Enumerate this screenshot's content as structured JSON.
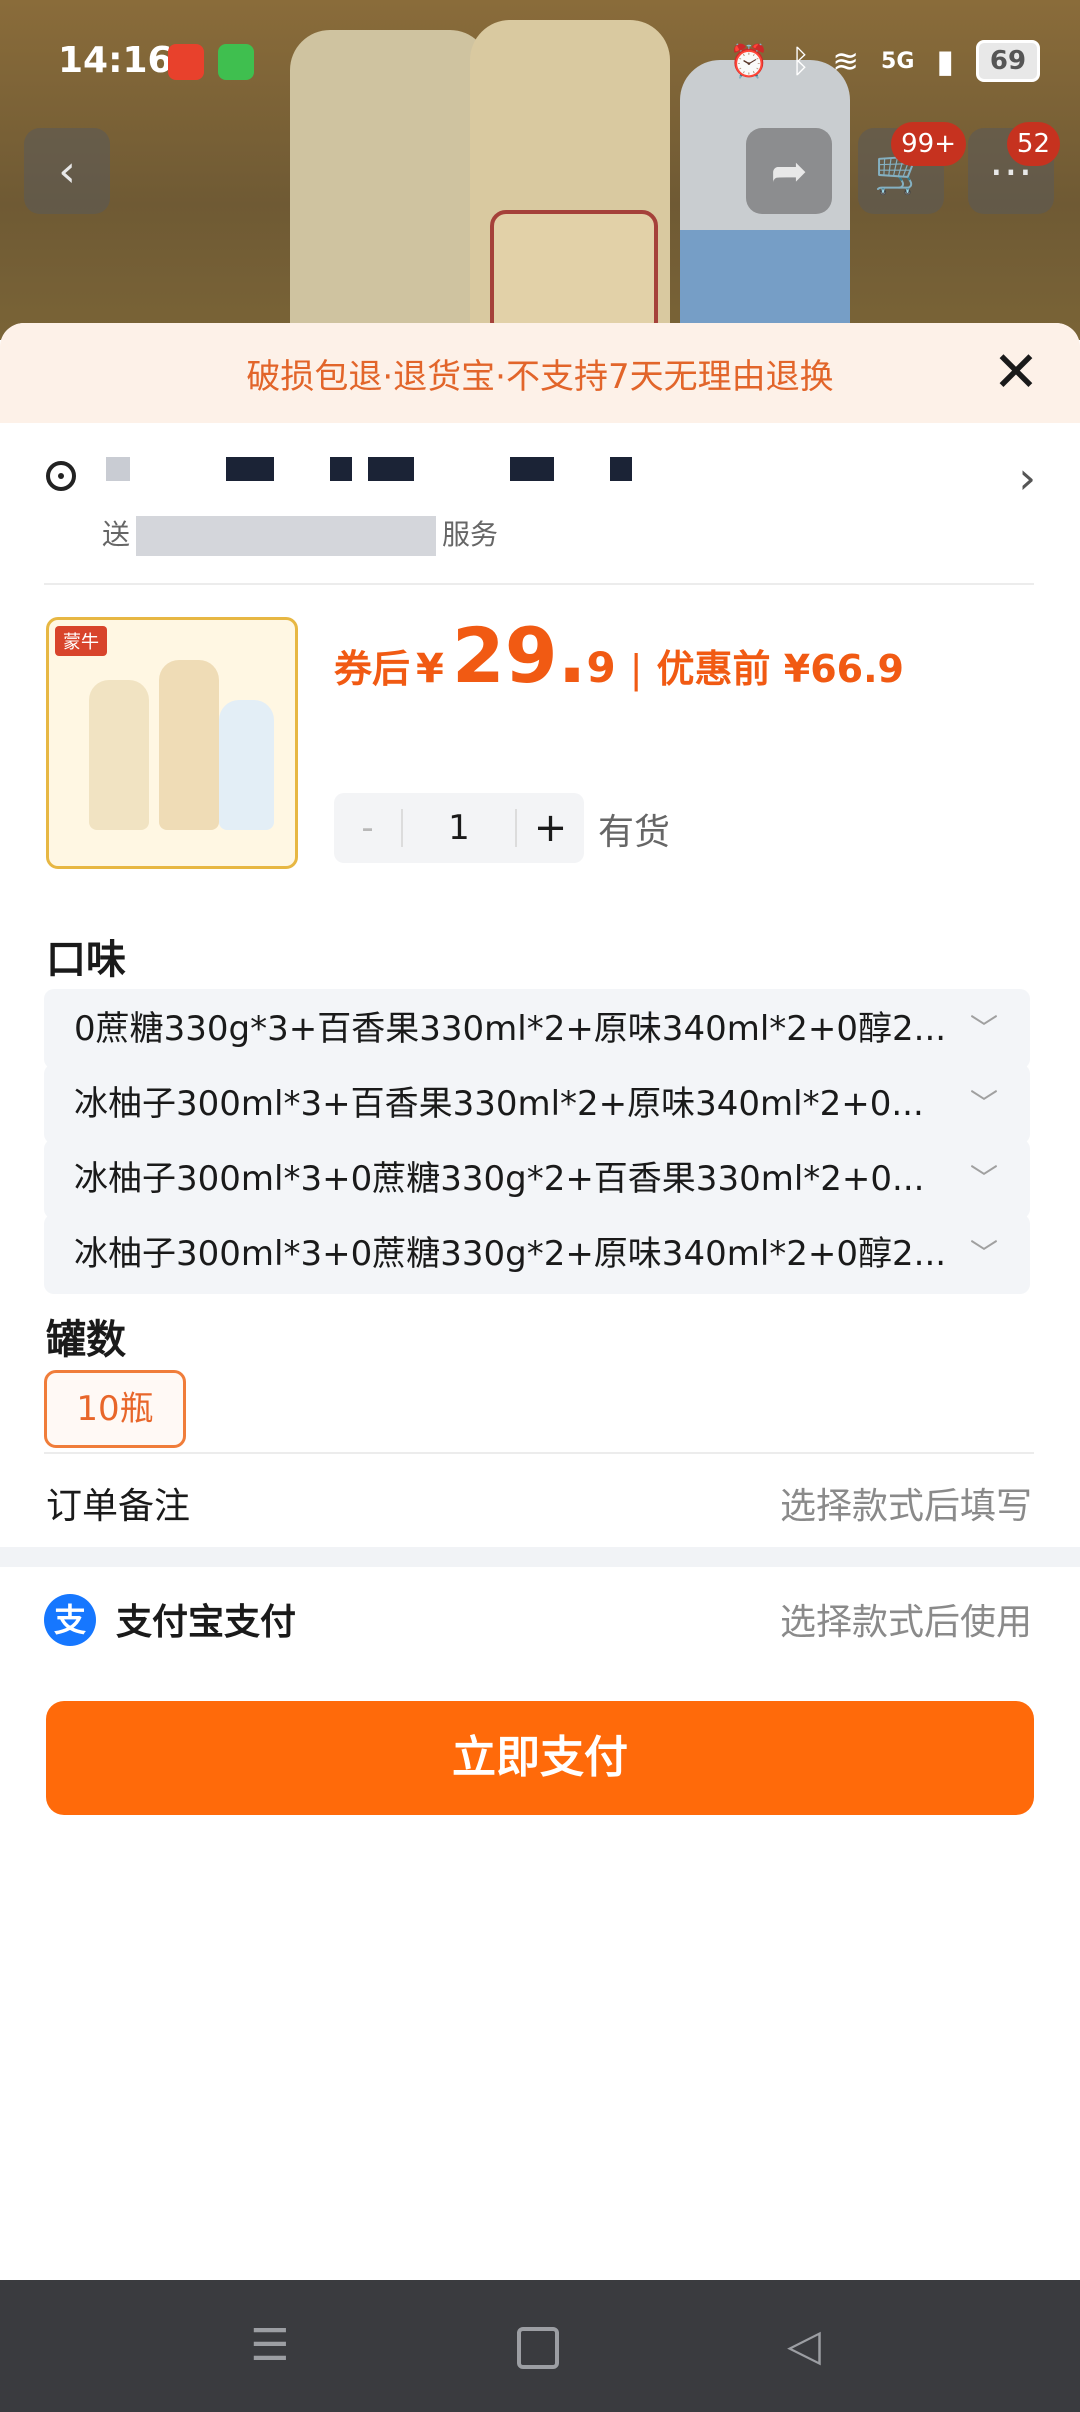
{
  "status_bar": {
    "time": "14:16",
    "network": "5G",
    "battery": "69",
    "icons": [
      "alarm-icon",
      "bluetooth-icon",
      "wifi-icon",
      "signal-icon"
    ]
  },
  "nav": {
    "cart_badge": "99+",
    "message_badge": "52"
  },
  "notice": {
    "text": "破损包退·退货宝·不支持7天无理由退换"
  },
  "address": {
    "line2_prefix": "送",
    "line2_suffix": "服务"
  },
  "product": {
    "image_tag": "蒙牛",
    "price_prefix": "券后",
    "currency": "¥",
    "price_int": "29.",
    "price_dec": "9",
    "separator": "|",
    "original_label": "优惠前 ¥66.9",
    "quantity": "1",
    "minus": "-",
    "plus": "+",
    "stock": "有货"
  },
  "flavor": {
    "title": "口味",
    "options": [
      "0蔗糖330g*3+百香果330ml*2+原味340ml*2+0醇2...",
      "冰柚子300ml*3+百香果330ml*2+原味340ml*2+0...",
      "冰柚子300ml*3+0蔗糖330g*2+百香果330ml*2+0...",
      "冰柚子300ml*3+0蔗糖330g*2+原味340ml*2+0醇2..."
    ]
  },
  "count": {
    "title": "罐数",
    "option": "10瓶"
  },
  "remark": {
    "label": "订单备注",
    "value": "选择款式后填写"
  },
  "payment": {
    "icon_glyph": "支",
    "label": "支付宝支付",
    "value": "选择款式后使用"
  },
  "pay_button": {
    "label": "立即支付"
  },
  "colors": {
    "accent": "#ff6a0a",
    "price": "#f15a13",
    "alipay": "#1677ff"
  }
}
